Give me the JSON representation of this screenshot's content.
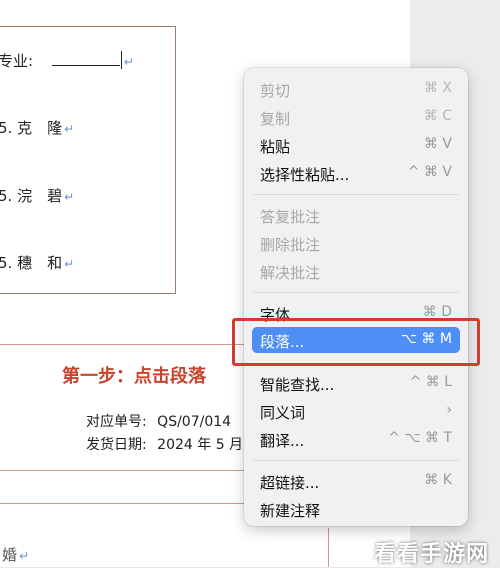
{
  "document": {
    "field_label": "专业:",
    "names": [
      "5. 克　隆",
      "5. 浣　碧",
      "5. 穗　和"
    ],
    "paragraph_mark": "↵",
    "step_title": "第一步：点击段落",
    "order_label": "对应单号:",
    "order_value": "QS/07/014",
    "ship_label": "发货日期:",
    "ship_value": "2024 年 5 月",
    "bottom_char": "婚"
  },
  "context_menu": {
    "items": [
      {
        "label": "剪切",
        "shortcut": "⌘ X",
        "enabled": false
      },
      {
        "label": "复制",
        "shortcut": "⌘ C",
        "enabled": false
      },
      {
        "label": "粘贴",
        "shortcut": "⌘ V",
        "enabled": true
      },
      {
        "label": "选择性粘贴...",
        "shortcut": "^ ⌘ V",
        "enabled": true
      },
      {
        "label": "答复批注",
        "shortcut": "",
        "enabled": false
      },
      {
        "label": "删除批注",
        "shortcut": "",
        "enabled": false
      },
      {
        "label": "解决批注",
        "shortcut": "",
        "enabled": false
      },
      {
        "label": "字体...",
        "shortcut": "⌘ D",
        "enabled": true
      },
      {
        "label": "段落...",
        "shortcut": "⌥ ⌘ M",
        "enabled": true,
        "selected": true
      },
      {
        "label": "智能查找...",
        "shortcut": "^ ⌘ L",
        "enabled": true
      },
      {
        "label": "同义词",
        "shortcut": "›",
        "enabled": true
      },
      {
        "label": "翻译...",
        "shortcut": "^ ⌥ ⌘ T",
        "enabled": true
      },
      {
        "label": "超链接...",
        "shortcut": "⌘ K",
        "enabled": true
      },
      {
        "label": "新建注释",
        "shortcut": "",
        "enabled": true
      }
    ]
  },
  "colors": {
    "selection": "#4e8ff5",
    "highlight_box": "#d43a2f",
    "step_title": "#c9442f"
  },
  "watermark": "看看手游网"
}
